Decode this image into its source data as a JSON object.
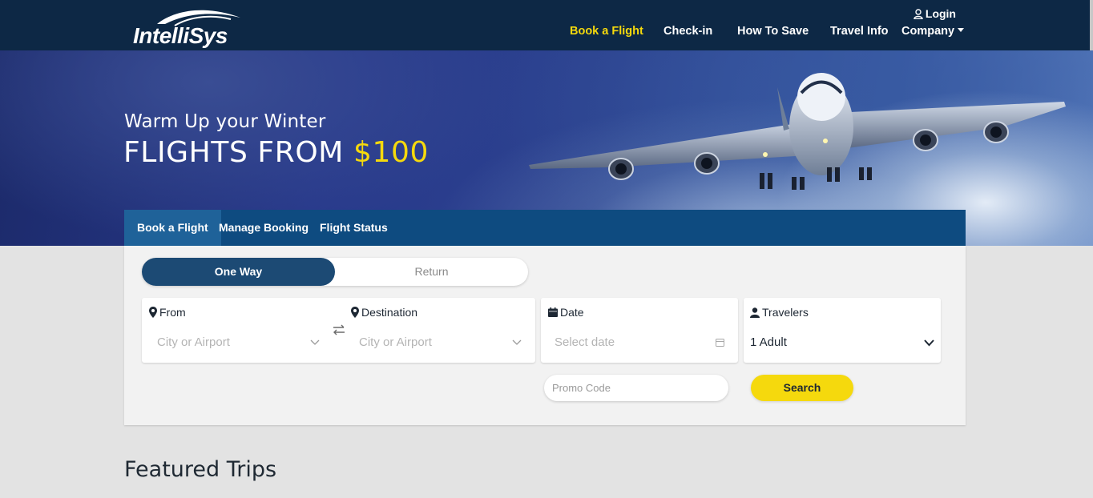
{
  "header": {
    "logo_text": "IntelliSys",
    "login_label": "Login",
    "nav": [
      {
        "label": "Book a Flight",
        "active": true
      },
      {
        "label": "Check-in",
        "active": false
      },
      {
        "label": "How To Save",
        "active": false
      },
      {
        "label": "Travel Info",
        "active": false
      },
      {
        "label": "Company",
        "active": false,
        "has_dropdown": true
      }
    ]
  },
  "hero": {
    "subtitle": "Warm Up your Winter",
    "headline": "FLIGHTS FROM",
    "price": "$100"
  },
  "tabs": [
    {
      "label": "Book a Flight",
      "active": true
    },
    {
      "label": "Manage Booking",
      "active": false
    },
    {
      "label": "Flight Status",
      "active": false
    }
  ],
  "booking": {
    "trip_types": [
      {
        "label": "One Way",
        "selected": true
      },
      {
        "label": "Return",
        "selected": false
      }
    ],
    "from": {
      "label": "From",
      "placeholder": "City or Airport"
    },
    "destination": {
      "label": "Destination",
      "placeholder": "City or Airport"
    },
    "date": {
      "label": "Date",
      "placeholder": "Select date"
    },
    "travelers": {
      "label": "Travelers",
      "value": "1 Adult"
    },
    "promo": {
      "placeholder": "Promo Code"
    },
    "search_label": "Search"
  },
  "featured_title": "Featured Trips",
  "colors": {
    "header_bg": "#0d2845",
    "accent_yellow": "#f5d90d",
    "tabbar_bg": "#0e4b80",
    "active_tab_bg": "#1f6299",
    "toggle_active": "#1c4a74"
  },
  "icons": [
    "user-icon",
    "caret-down-icon",
    "map-pin-icon",
    "swap-icon",
    "calendar-icon",
    "chevron-down-icon"
  ]
}
